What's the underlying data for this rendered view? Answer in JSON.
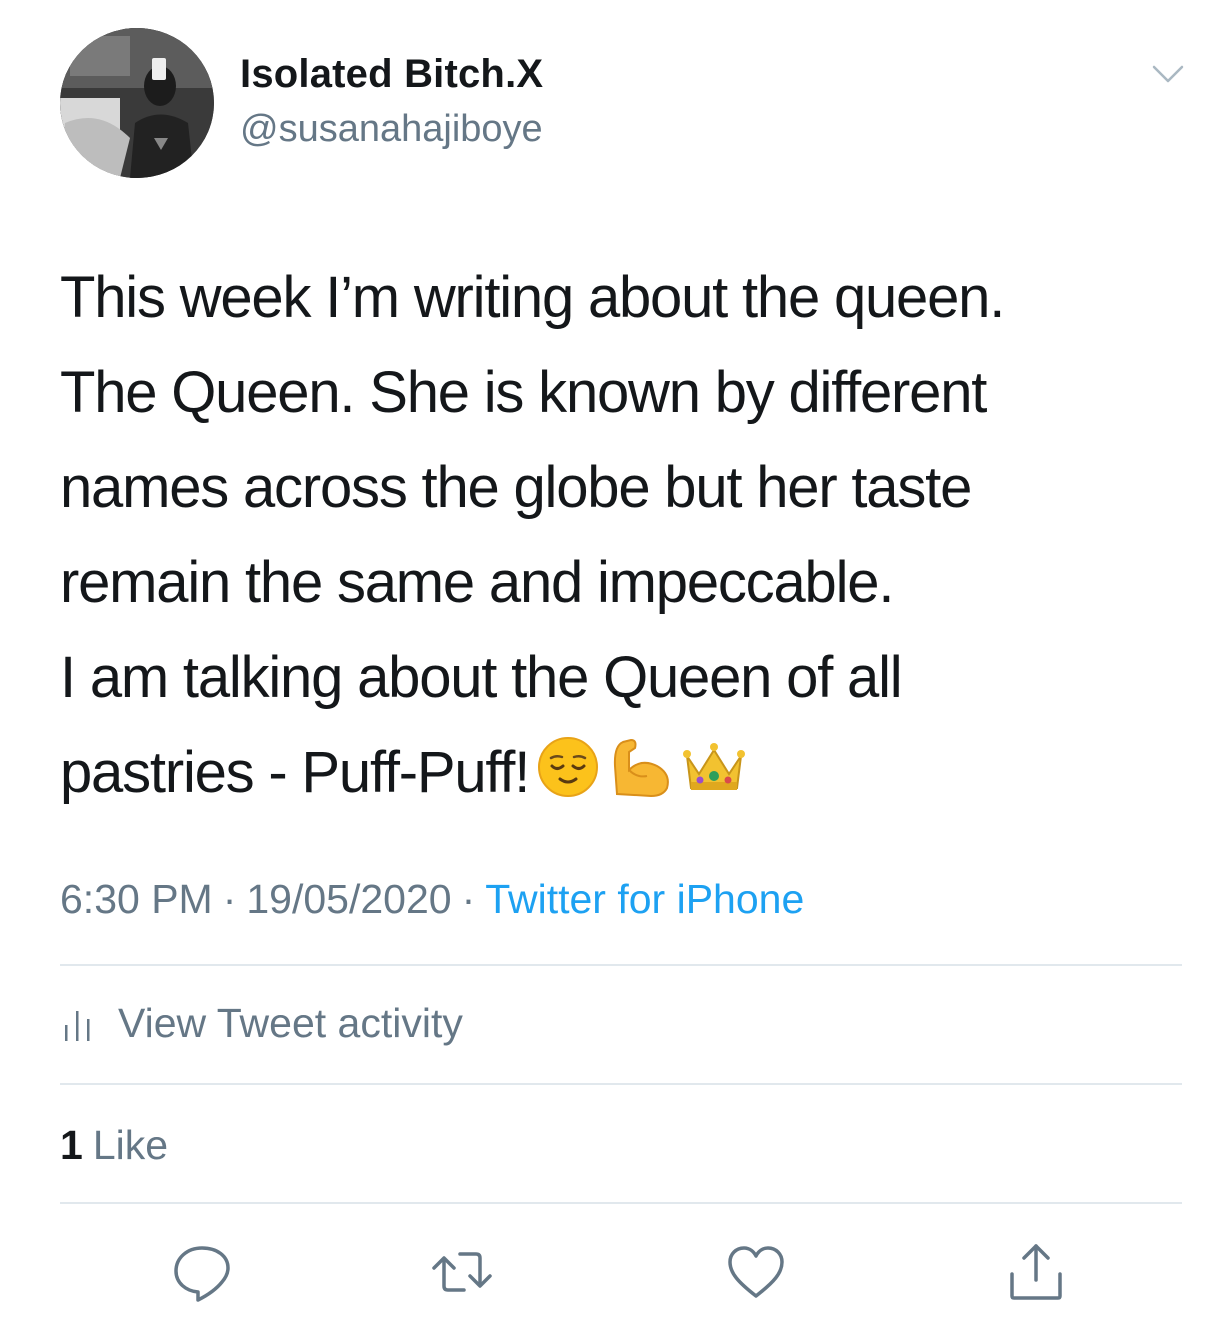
{
  "author": {
    "display_name": "Isolated Bitch.X",
    "handle": "@susanahajiboye"
  },
  "tweet": {
    "lines": [
      "This week I’m writing about the queen.",
      "The Queen. She is known by different",
      "names across the globe but her taste",
      "remain the same and impeccable.",
      "I am talking about the Queen of all",
      "pastries - Puff-Puff!"
    ],
    "emojis": [
      "relieved-face",
      "flexed-biceps",
      "crown"
    ]
  },
  "meta": {
    "time": "6:30 PM",
    "separator": "·",
    "date": "19/05/2020",
    "source": "Twitter for iPhone"
  },
  "activity": {
    "label": "View Tweet activity"
  },
  "likes": {
    "count": "1",
    "label": "Like"
  },
  "colors": {
    "text": "#14171a",
    "secondary": "#657786",
    "link": "#1da1f2",
    "divider": "#e1e8ed"
  }
}
